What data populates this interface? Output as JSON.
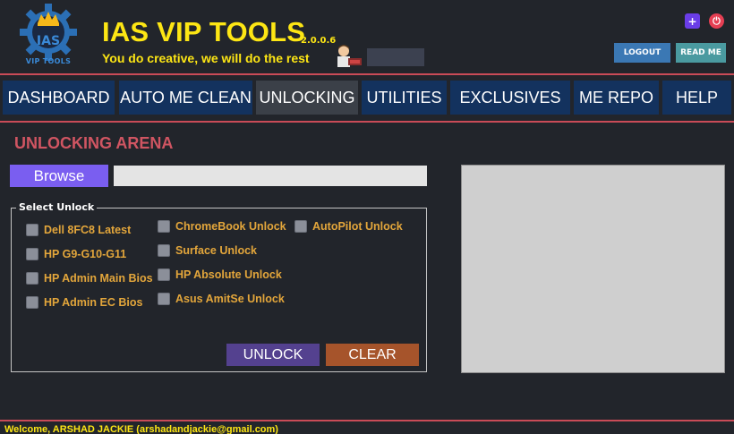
{
  "app": {
    "logo_text": "IAS",
    "logo_subtext": "VIP TOOLS",
    "title": "IAS VIP TOOLS",
    "version": "2.0.0.6",
    "tagline": "You do creative, we will do the rest"
  },
  "header": {
    "plus_icon": "+",
    "exit_icon": "⏻",
    "logout_label": "LOGOUT",
    "readme_label": "READ ME"
  },
  "nav": {
    "items": [
      {
        "label": "DASHBOARD"
      },
      {
        "label": "AUTO ME CLEAN"
      },
      {
        "label": "UNLOCKING"
      },
      {
        "label": "UTILITIES"
      },
      {
        "label": "EXCLUSIVES"
      },
      {
        "label": "ME REPO"
      },
      {
        "label": "HELP"
      }
    ],
    "active": "UNLOCKING"
  },
  "main": {
    "section_title": "UNLOCKING ARENA",
    "browse_label": "Browse",
    "path_value": "",
    "group_title": "Select Unlock",
    "options": [
      {
        "label": "Dell 8FC8 Latest",
        "checked": false
      },
      {
        "label": "HP G9-G10-G11",
        "checked": false
      },
      {
        "label": "HP Admin Main Bios",
        "checked": false
      },
      {
        "label": "HP Admin EC Bios",
        "checked": false
      },
      {
        "label": "ChromeBook Unlock",
        "checked": false
      },
      {
        "label": "Surface Unlock",
        "checked": false
      },
      {
        "label": "HP Absolute Unlock",
        "checked": false
      },
      {
        "label": "Asus AmitSe Unlock",
        "checked": false
      },
      {
        "label": "AutoPilot Unlock",
        "checked": false
      }
    ],
    "unlock_label": "UNLOCK",
    "clear_label": "CLEAR"
  },
  "footer": {
    "welcome": "Welcome, ARSHAD JACKIE (arshadandjackie@gmail.com)"
  },
  "colors": {
    "background": "#22252b",
    "accent_yellow": "#fde614",
    "nav_bg": "#13325e",
    "nav_active": "#3b4048",
    "section_title": "#d05562",
    "option_text": "#e3a63b",
    "browse": "#7a5ef0",
    "unlock": "#54418f",
    "clear": "#a6542b"
  }
}
